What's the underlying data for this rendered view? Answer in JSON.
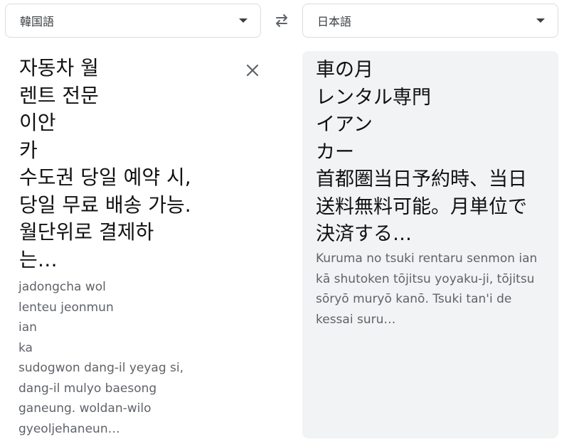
{
  "source_language": {
    "label": "韓国語"
  },
  "target_language": {
    "label": "日本語"
  },
  "source": {
    "text": "자동차  월\n렌트 전문\n이안\n카\n수도권 당일 예약 시,\n당일 무료 배송 가능.\n월단위로 결제하\n는…",
    "romanization": "jadongcha  wol\nlenteu jeonmun\nian\nka\nsudogwon dang-il yeyag si,\ndang-il mulyo baesong\nganeung. woldan-wilo\ngyeoljehaneun…"
  },
  "target": {
    "text": "車の月\nレンタル専門\nイアン\nカー\n首都圏当日予約時、当日\n送料無料可能。月単位で\n決済する…",
    "romanization": "Kuruma no tsuki rentaru senmon ian\nkā shutoken tōjitsu yoyaku-ji, tōjitsu\nsōryō muryō kanō. Tsuki tan'i de\nkessai suru…"
  },
  "icons": {
    "swap": "swap-arrows-icon",
    "clear": "close-icon",
    "dropdown": "chevron-down-icon"
  },
  "colors": {
    "panel_background": "#f1f3f4",
    "border": "#dadce0",
    "secondary_text": "#5f6368"
  }
}
